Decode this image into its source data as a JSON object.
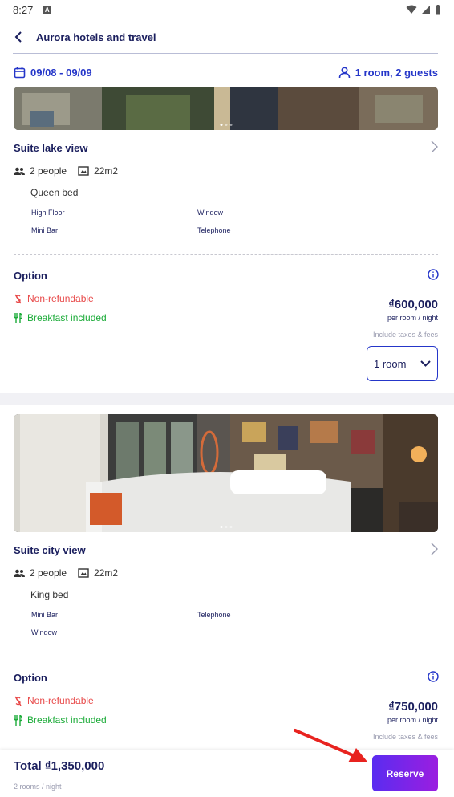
{
  "status": {
    "time": "8:27"
  },
  "header": {
    "title": "Aurora hotels and travel"
  },
  "search": {
    "dates": "09/08 - 09/09",
    "guests": "1 room, 2 guests"
  },
  "rooms": [
    {
      "name": "Suite lake view",
      "people": "2 people",
      "area": "22m2",
      "bed": "Queen bed",
      "amenities": [
        "High Floor",
        "Window",
        "Mini Bar",
        "Telephone"
      ],
      "option": {
        "title": "Option",
        "refund": "Non-refundable",
        "breakfast": "Breakfast included",
        "price": "₫600,000",
        "per": "per room / night",
        "taxes": "Include taxes & fees",
        "selected_rooms": "1 room"
      }
    },
    {
      "name": "Suite city view",
      "people": "2 people",
      "area": "22m2",
      "bed": "King bed",
      "amenities": [
        "Mini Bar",
        "Telephone",
        "Window"
      ],
      "option": {
        "title": "Option",
        "refund": "Non-refundable",
        "breakfast": "Breakfast included",
        "price": "₫750,000",
        "per": "per room / night",
        "taxes": "Include taxes & fees"
      }
    }
  ],
  "footer": {
    "total": "Total ₫1,350,000",
    "sub": "2 rooms / night",
    "reserve_label": "Reserve"
  },
  "colors": {
    "accent": "#2536c9",
    "text": "#1b1f5e",
    "red": "#e84a4a",
    "green": "#1bab38",
    "reserve_start": "#5a2cf0",
    "reserve_end": "#9b1ee0"
  }
}
